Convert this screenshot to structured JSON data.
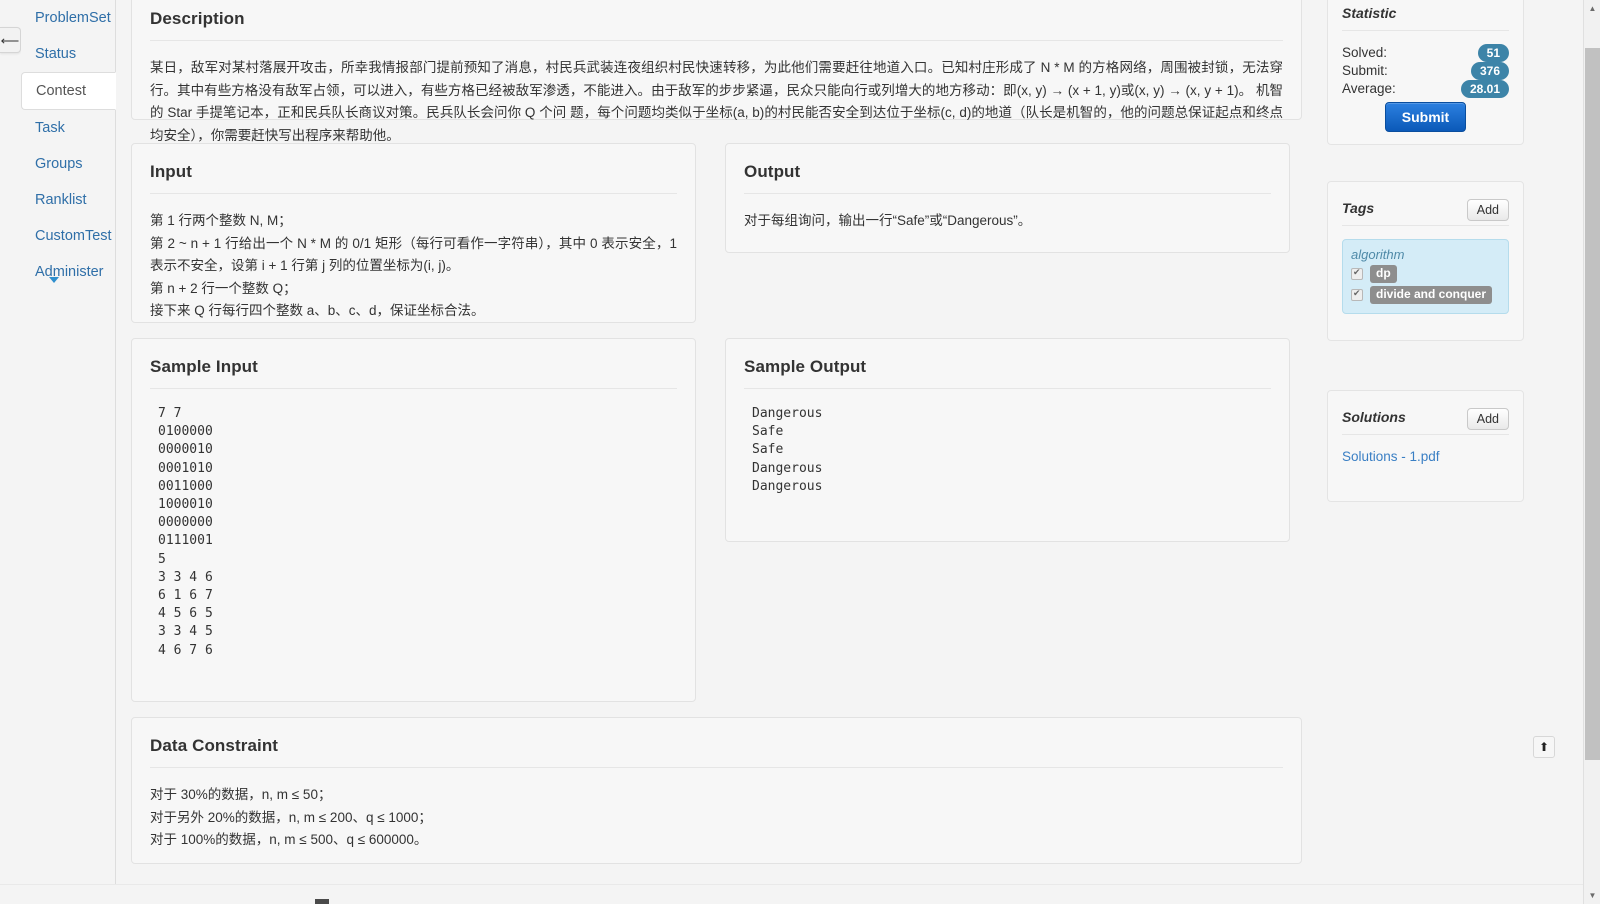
{
  "sidebar": {
    "collapse_icon": "left-arrow-icon",
    "items": [
      {
        "label": "ProblemSet",
        "active": false
      },
      {
        "label": "Status",
        "active": false
      },
      {
        "label": "Contest",
        "active": true
      },
      {
        "label": "Task",
        "active": false
      },
      {
        "label": "Groups",
        "active": false
      },
      {
        "label": "Ranklist",
        "active": false
      },
      {
        "label": "CustomTest",
        "active": false
      },
      {
        "label": "Administer",
        "active": false
      }
    ]
  },
  "sections": {
    "description": {
      "title": "Description",
      "text": "某日，敌军对某村落展开攻击，所幸我情报部门提前预知了消息，村民兵武装连夜组织村民快速转移，为此他们需要赶往地道入口。已知村庄形成了 N * M 的方格网络，周围被封锁，无法穿行。其中有些方格没有敌军占领，可以进入，有些方格已经被敌军渗透，不能进入。由于敌军的步步紧逼，民众只能向行或列增大的地方移动：即(x, y) → (x + 1, y)或(x, y) → (x, y + 1)。 机智的 Star 手提笔记本，正和民兵队长商议对策。民兵队长会问你 Q 个问 题，每个问题均类似于坐标(a, b)的村民能否安全到达位于坐标(c, d)的地道（队长是机智的，他的问题总保证起点和终点均安全），你需要赶快写出程序来帮助他。"
    },
    "input": {
      "title": "Input",
      "lines": [
        "第 1 行两个整数 N, M；",
        "第 2 ~ n + 1 行给出一个 N * M 的 0/1 矩形（每行可看作一字符串），其中 0 表示安全，1 表示不安全，设第 i + 1 行第 j 列的位置坐标为(i, j)。",
        "第 n + 2 行一个整数 Q；",
        "接下来 Q 行每行四个整数 a、b、c、d，保证坐标合法。"
      ]
    },
    "output": {
      "title": "Output",
      "lines": [
        "对于每组询问，输出一行“Safe”或“Dangerous”。"
      ]
    },
    "sample_input": {
      "title": "Sample Input",
      "code": "7 7\n0100000\n0000010\n0001010\n0011000\n1000010\n0000000\n0111001\n5\n3 3 4 6\n6 1 6 7\n4 5 6 5\n3 3 4 5\n4 6 7 6"
    },
    "sample_output": {
      "title": "Sample Output",
      "code": "Dangerous\nSafe\nSafe\nDangerous\nDangerous"
    },
    "data_constraint": {
      "title": "Data Constraint",
      "lines": [
        "对于 30%的数据，n, m ≤ 50；",
        "对于另外 20%的数据，n, m ≤ 200、q ≤ 1000；",
        "对于 100%的数据，n, m ≤ 500、q ≤ 600000。"
      ]
    }
  },
  "statistic": {
    "title": "Statistic",
    "rows": [
      {
        "label": "Solved:",
        "value": "51"
      },
      {
        "label": "Submit:",
        "value": "376"
      },
      {
        "label": "Average:",
        "value": "28.01"
      }
    ],
    "submit_label": "Submit",
    "badge_color": "#3d84a8",
    "button_color": "#1466c7"
  },
  "tags": {
    "title": "Tags",
    "add_label": "Add",
    "group_name": "algorithm",
    "items": [
      {
        "label": "dp",
        "checked": true
      },
      {
        "label": "divide and conquer",
        "checked": true
      }
    ],
    "box_color": "#d4ecf7"
  },
  "solutions": {
    "title": "Solutions",
    "add_label": "Add",
    "files": [
      {
        "label": "Solutions - 1.pdf"
      }
    ]
  },
  "controls": {
    "scroll_top_icon": "arrow-up-icon",
    "scroll_up_icon": "triangle-up-icon",
    "scroll_down_icon": "triangle-down-icon"
  }
}
